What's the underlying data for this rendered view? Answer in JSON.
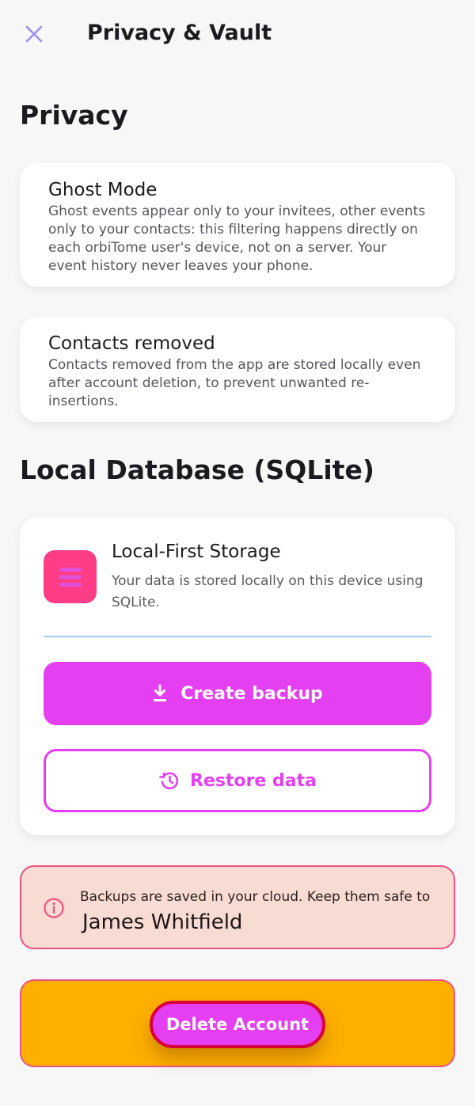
{
  "header": {
    "title": "Privacy & Vault",
    "close_icon": "close-icon"
  },
  "privacy": {
    "title": "Privacy",
    "cards": [
      {
        "title": "Ghost Mode",
        "description": "Ghost events appear only to your invitees, other events only to your contacts: this filtering happens directly on each orbiTome user's device, not on a server. Your event history never leaves your phone."
      },
      {
        "title": "Contacts removed",
        "description": "Contacts removed from the app are stored locally even after account deletion, to prevent unwanted re-insertions."
      }
    ]
  },
  "database": {
    "title": "Local Database (SQLite)",
    "storage_title": "Local-First Storage",
    "storage_description": "Your data is stored locally on this device using SQLite.",
    "storage_icon": "database-icon",
    "backup_label": "Create backup",
    "backup_icon": "download-icon",
    "restore_label": "Restore data",
    "restore_icon": "history-icon"
  },
  "notice": {
    "icon": "info-icon",
    "text": "Backups are saved in your cloud. Keep them safe to",
    "name": "James Whitfield"
  },
  "account": {
    "delete_label": "Delete Account"
  },
  "colors": {
    "accent": "#e53ff2",
    "db_icon_bg": "#ff3d86",
    "notice_bg": "#f8dcd3",
    "notice_border": "#ef5282",
    "danger_bg": "#ffaf00",
    "delete_border": "#d8003b",
    "close_icon": "#9b8ef0"
  }
}
